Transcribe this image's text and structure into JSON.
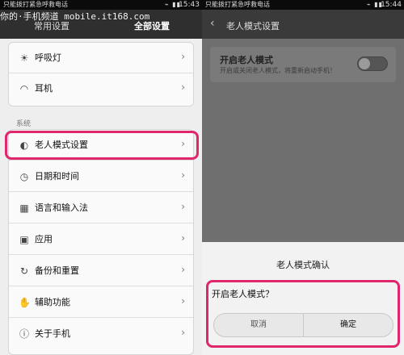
{
  "left": {
    "status_bar": {
      "carrier": "只能拨打紧急呼救电话",
      "icons": "⌁ ▮▮",
      "time": "15:43"
    },
    "watermark": "你的·手机频道 mobile.it168.com",
    "tabs": {
      "common": "常用设置",
      "all": "全部设置"
    },
    "items_top": [
      {
        "icon": "☀",
        "label": "呼吸灯"
      },
      {
        "icon": "◠",
        "label": "耳机"
      }
    ],
    "section_label": "系统",
    "items_system": [
      {
        "icon": "◐",
        "label": "老人模式设置"
      },
      {
        "icon": "◷",
        "label": "日期和时间"
      },
      {
        "icon": "▦",
        "label": "语言和输入法"
      },
      {
        "icon": "▣",
        "label": "应用"
      },
      {
        "icon": "↻",
        "label": "备份和重置"
      },
      {
        "icon": "✋",
        "label": "辅助功能"
      },
      {
        "icon": "ⓘ",
        "label": "关于手机"
      }
    ],
    "chevron": "›",
    "accent_color": "#e0266c"
  },
  "right": {
    "status_bar": {
      "carrier": "只能拨打紧急呼救电话",
      "icons": "⌁ ▮▮",
      "time": "15:44"
    },
    "header": {
      "back": "‹",
      "title": "老人模式设置"
    },
    "toggle": {
      "title": "开启老人模式",
      "subtitle": "开启或关闭老人模式，将重新启动手机！",
      "state": "off"
    },
    "dialog": {
      "title": "老人模式确认",
      "message": "开启老人模式？",
      "cancel_label": "取消",
      "confirm_label": "确定"
    }
  }
}
